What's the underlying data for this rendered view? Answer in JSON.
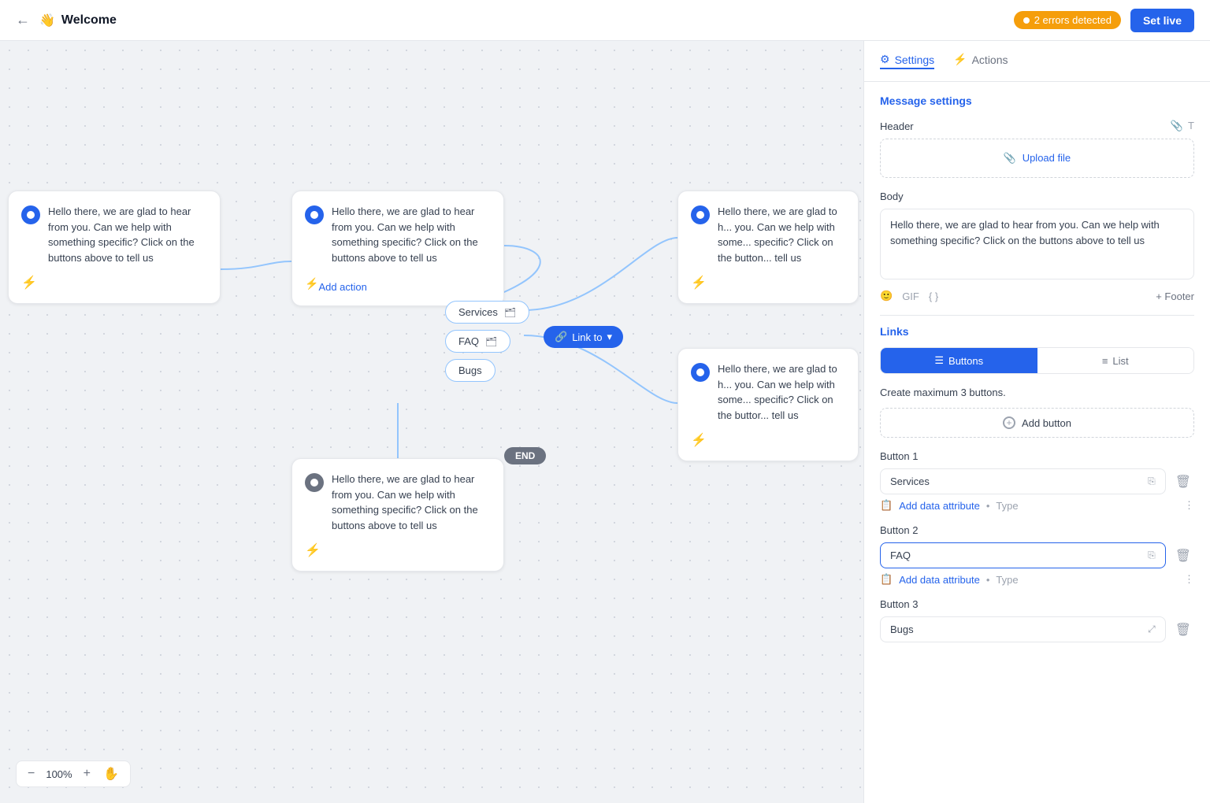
{
  "topbar": {
    "title": "Welcome",
    "emoji": "👋",
    "errors_count": "2 errors detected",
    "set_live_label": "Set live"
  },
  "zoom": {
    "minus_label": "−",
    "level": "100%",
    "plus_label": "+",
    "hand_label": "✋"
  },
  "canvas": {
    "nodes": [
      {
        "id": "node-1",
        "text": "Hello there, we are glad to hear from you. Can we help with something specific? Click on the buttons above to tell us"
      },
      {
        "id": "node-2",
        "text": "Hello there, we are glad to hear from you. Can we help with something specific? Click on the buttons above to tell us",
        "add_action": "Add action"
      },
      {
        "id": "node-3",
        "text": "Hello there, we are glad to hear from you. Can we help with something specific? Click on the buttons above to tell us"
      },
      {
        "id": "node-4",
        "text": "Hello there, we are glad to hear from you. Can we help with something specific? Click on the buttons above to tell us"
      },
      {
        "id": "node-5",
        "text": "Hello there, we are glad to hear from you. Can we help with something specific? Click on the buttons above to tell us"
      }
    ],
    "pills": [
      "Services",
      "FAQ",
      "Bugs"
    ],
    "link_to": "Link to",
    "end_badge": "END"
  },
  "panel": {
    "tab_settings": "Settings",
    "tab_actions": "Actions",
    "section_message_settings": "Message settings",
    "header_label": "Header",
    "upload_label": "Upload file",
    "body_label": "Body",
    "body_text": "Hello there, we are glad to hear from you. Can we help with something specific? Click on the buttons above to tell us",
    "body_gif": "GIF",
    "body_code": "{ }",
    "footer_label": "+ Footer",
    "links_label": "Links",
    "tab_buttons": "Buttons",
    "tab_list": "List",
    "create_max": "Create maximum 3 buttons.",
    "add_button_label": "Add button",
    "button1_label": "Button 1",
    "button1_value": "Services",
    "button2_label": "Button 2",
    "button2_value": "FAQ",
    "button3_label": "Button 3",
    "button3_value": "Bugs",
    "add_data_attr": "Add data attribute",
    "data_type": "Type"
  }
}
